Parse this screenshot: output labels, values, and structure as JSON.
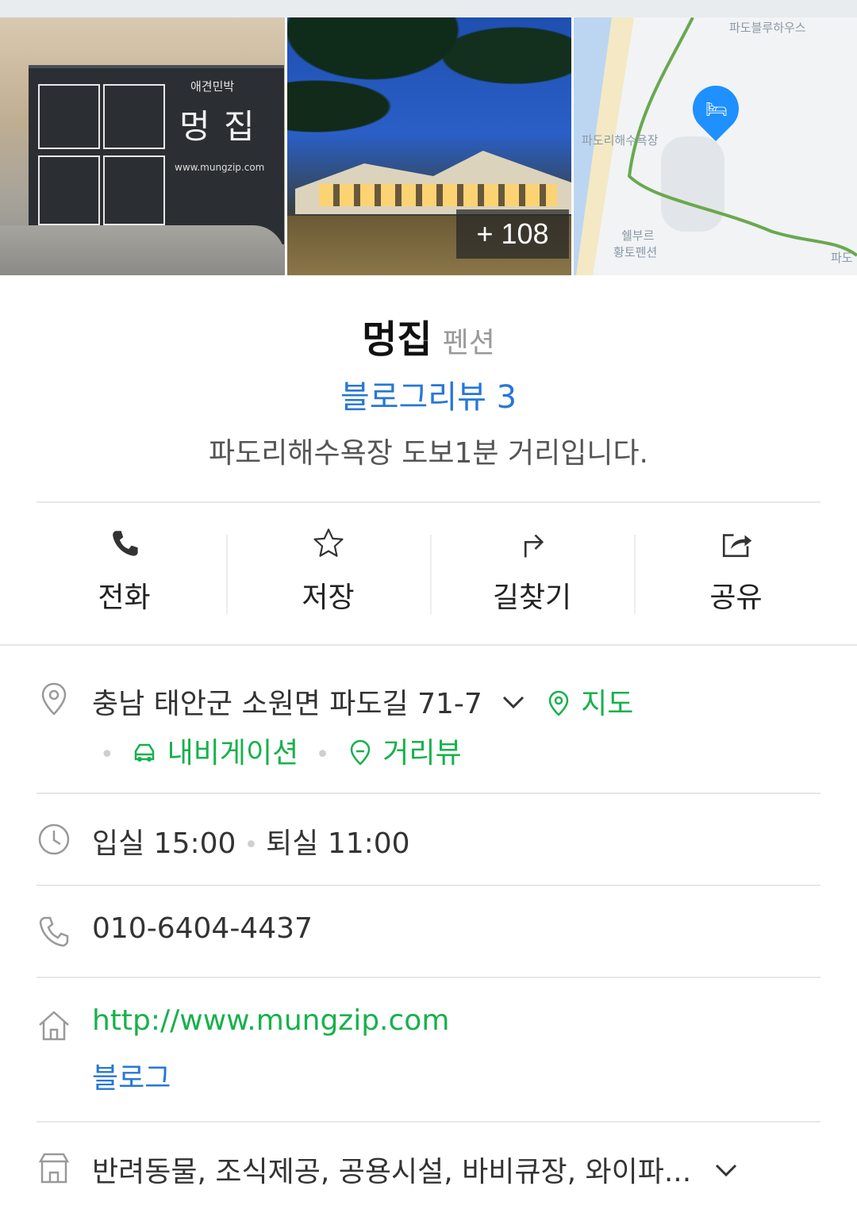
{
  "photos": {
    "more_count": "+ 108",
    "photo1_sign": {
      "subtitle": "애견민박",
      "title": "멍 집",
      "url": "www.mungzip.com"
    },
    "map_labels": {
      "top_right": "파도블루하우스",
      "beach": "파도리해수욕장",
      "pension_line1": "쉘부르",
      "pension_line2": "황토펜션",
      "edge": "파도"
    }
  },
  "place": {
    "name": "멍집",
    "category": "펜션",
    "review": "블로그리뷰 3",
    "description": "파도리해수욕장 도보1분 거리입니다."
  },
  "actions": [
    {
      "label": "전화",
      "icon": "phone-icon"
    },
    {
      "label": "저장",
      "icon": "star-icon"
    },
    {
      "label": "길찾기",
      "icon": "directions-icon"
    },
    {
      "label": "공유",
      "icon": "share-icon"
    }
  ],
  "info": {
    "address": "충남 태안군 소원면 파도길 71-7",
    "map_link": "지도",
    "navigation_link": "내비게이션",
    "streetview_link": "거리뷰",
    "checkin": "입실 15:00",
    "checkout": "퇴실 11:00",
    "phone": "010-6404-4437",
    "homepage": "http://www.mungzip.com",
    "blog": "블로그",
    "amenities": "반려동물, 조식제공, 공용시설, 바비큐장, 와이파..."
  },
  "colors": {
    "link_blue": "#2777d6",
    "link_green": "#17b14c",
    "pin_blue": "#1e90ff"
  }
}
